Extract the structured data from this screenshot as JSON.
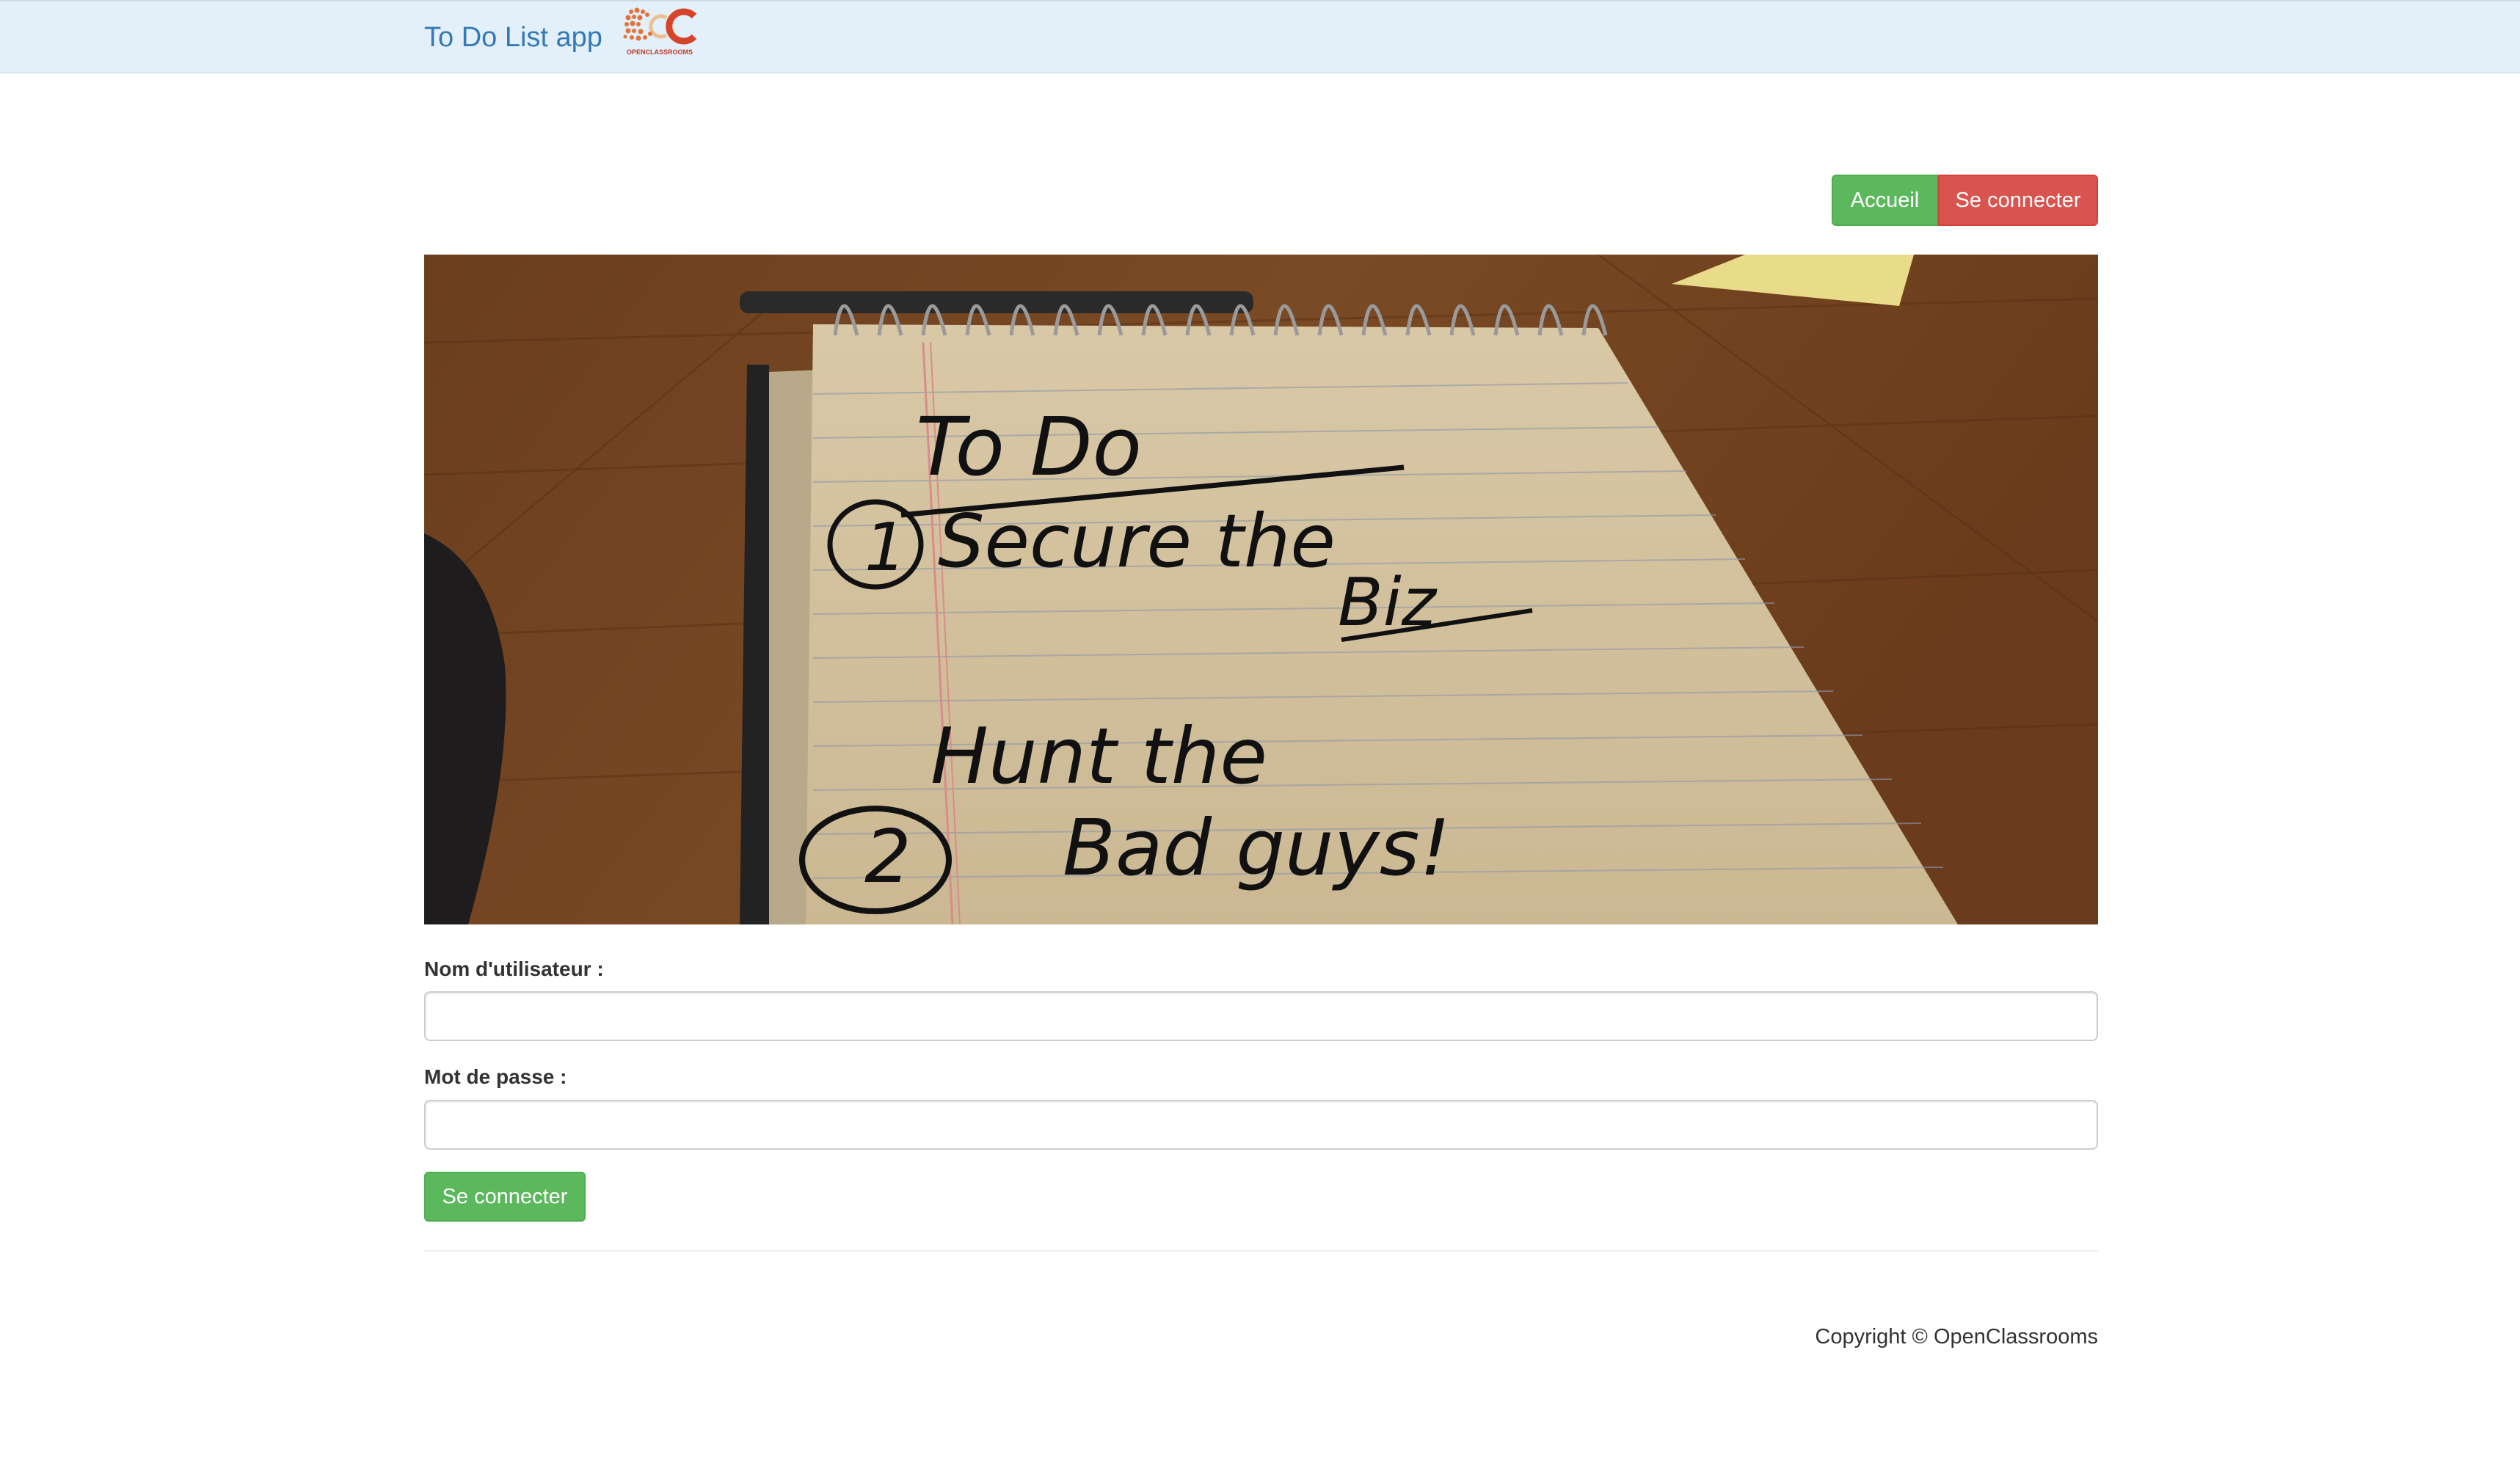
{
  "navbar": {
    "brand": "To Do List app",
    "logo_text": "OPENCLASSROOMS"
  },
  "actions": {
    "home_label": "Accueil",
    "login_label": "Se connecter"
  },
  "hero": {
    "note_lines": [
      "To Do",
      "Secure the",
      "Biz",
      "Hunt the",
      "Bad guys!"
    ],
    "note_numbers": [
      "1",
      "2"
    ]
  },
  "form": {
    "username_label": "Nom d'utilisateur :",
    "username_value": "",
    "password_label": "Mot de passe :",
    "password_value": "",
    "submit_label": "Se connecter"
  },
  "footer": {
    "copyright": "Copyright © OpenClassrooms"
  },
  "colors": {
    "navbar_bg": "#e3f0fa",
    "brand": "#337ab7",
    "success": "#5cb85c",
    "danger": "#d9534f"
  }
}
